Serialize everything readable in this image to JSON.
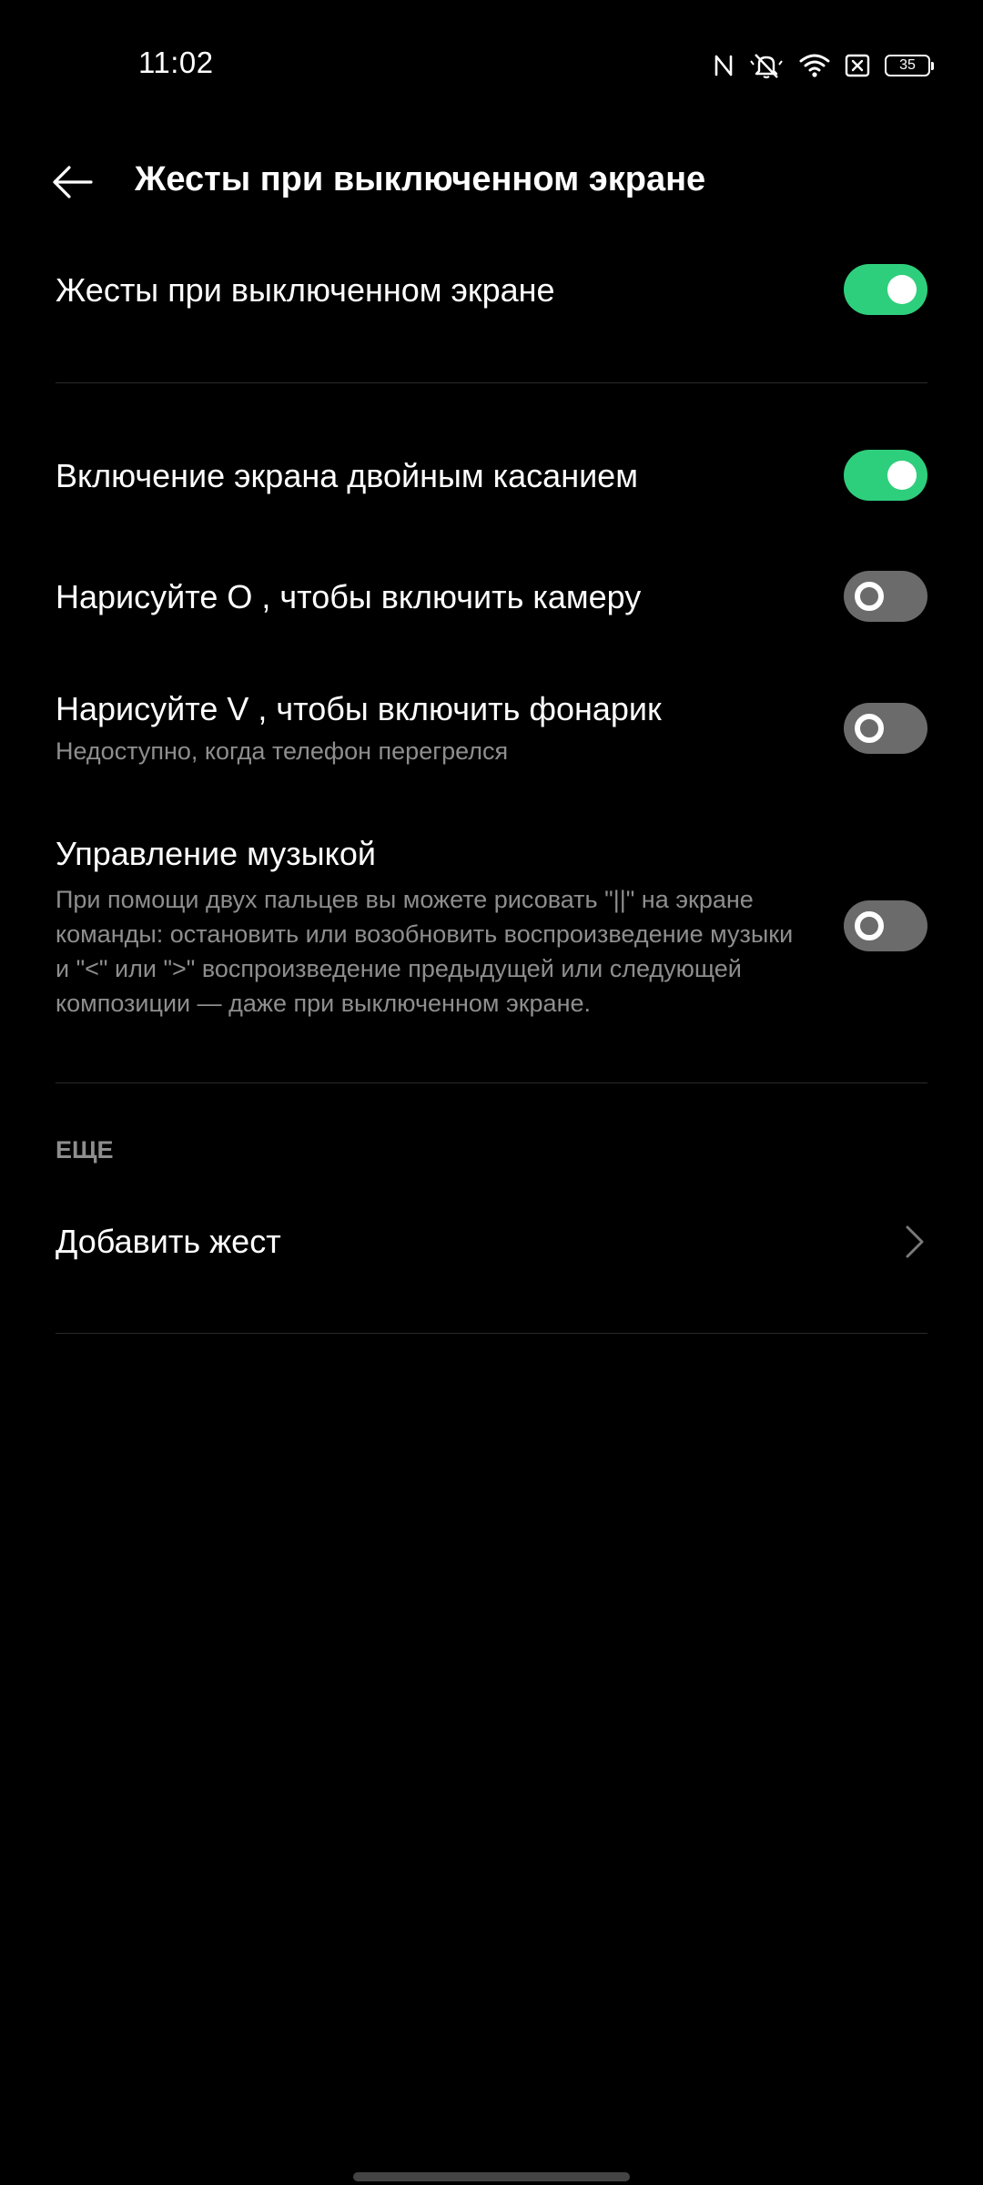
{
  "status_bar": {
    "time": "11:02",
    "battery": "35",
    "icons": [
      "nfc-icon",
      "silent-bell-icon",
      "wifi-icon",
      "sim-off-icon",
      "battery-icon"
    ]
  },
  "header": {
    "title": "Жесты при выключенном экране",
    "back_icon": "back-arrow-icon"
  },
  "settings": {
    "master": {
      "label": "Жесты при выключенном экране",
      "enabled": true
    },
    "double_tap": {
      "label": "Включение экрана двойным касанием",
      "enabled": true
    },
    "camera": {
      "label": "Нарисуйте  O , чтобы включить камеру",
      "enabled": false
    },
    "flashlight": {
      "label": "Нарисуйте  V , чтобы включить фонарик",
      "subtitle": "Недоступно, когда телефон перегрелся",
      "enabled": false
    },
    "music": {
      "label": "Управление музыкой",
      "subtitle": "При помощи двух пальцев вы можете рисовать \"||\" на экране команды: остановить или возобновить воспроизведение музыки и \"<\" или \">\" воспроизведение предыдущей или следующей композиции — даже при выключенном экране.",
      "enabled": false
    }
  },
  "more": {
    "section_label": "ЕЩЕ",
    "add_gesture_label": "Добавить жест"
  },
  "colors": {
    "background": "#000000",
    "toggle_on": "#2ecf7c",
    "toggle_off": "#6b6b6b",
    "secondary_text": "#8e8e8e",
    "divider": "#2a2a2a"
  }
}
